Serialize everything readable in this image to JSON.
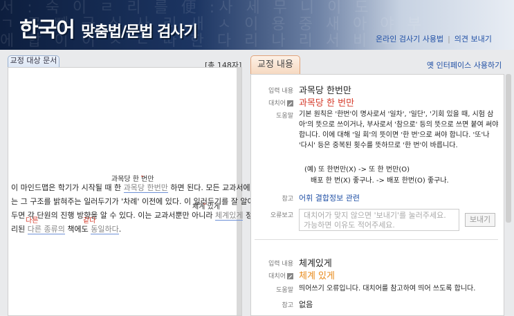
{
  "header": {
    "title_main": "한국어 ",
    "title_rest": "맞춤법/문법 검사기",
    "link_manual": "온라인 검사기 사용법",
    "link_separator": "|",
    "link_feedback": "의견 보내기",
    "bg_glyphs": [
      "서 :  숙 이 ㄹ 리 를    便 :사 세   무 니 이 도",
      "ㄱ 로 빼 금 식 사 리 새 ㅅ  이 용   중 새 아 야 부",
      "에  합 이 이 ㅅ ㄷ 따 한  다 리  나 리   서 비 ㄹ"
    ]
  },
  "left_panel": {
    "tab_label": "교정 대상 문서",
    "char_count": "[총 148자]",
    "lines": [
      {
        "pre": "이 마인드맵은 학기가 시작될 때 한 ",
        "err": "과목당 한번만",
        "post": " 하면 된다. 모든 교과서에",
        "sugg": "과목당 한 번만"
      },
      {
        "pre": "는 그 구조를 밝혀주는 일러두기가 '차례' 이전에 있다. 이 일러두기를 잘 알아",
        "err": "",
        "post": "",
        "sugg": ""
      },
      {
        "pre": "두면 각 단원의 진행 방향을 알 수 있다. 이는 교과서뿐만 아니라 ",
        "err": "체계있게",
        "post": " 정",
        "sugg": "체계 있게"
      },
      {
        "pre": "리된 ",
        "err": "다른 종류의",
        "mid": " 책에도 ",
        "err2": "동일하다",
        "post": ".",
        "sugg": "다른",
        "sugg2": "같다"
      }
    ]
  },
  "right_panel": {
    "tab_label": "교정 내용",
    "old_ui_link": "옛 인터페이스 사용하기",
    "entry1": {
      "input_label": "입력 내용",
      "input_value": "과목당 한번만",
      "replace_label": "대치어",
      "replace_value": "과목당 한 번만",
      "help_label": "도움말",
      "help_text": "기본 원칙은 '한번'이 명사로서 '일차', '일단', '기회 있을 때, 시험 삼아'의 뜻으로 쓰이거나, 부사로서 '참으로' 등의 뜻으로 쓰면 붙여 써야 합니다. 이에 대해 '일 회'의 뜻이면 '한 번'으로 써야 합니다. '또'나 '다시' 등은 중복된 횟수를 뜻하므로 '한 번'이 바릅니다.",
      "example1": "(예) 또 한번만(X) -> 또 한 번만(O)",
      "example2": "배포 한 번(X) 좋구나. -> 배포 한번(O) 좋구나.",
      "ref_label": "참고",
      "ref_value": "어휘 결합정보 관련",
      "report_label": "오류보고",
      "report_placeholder": "대치어가 맞지 않으면 '보내기'를 눌러주세요. 가능하면 이유도 적어주세요.",
      "send_label": "보내기"
    },
    "entry2": {
      "input_label": "입력 내용",
      "input_value": "체계있게",
      "replace_label": "대치어",
      "replace_value": "체계 있게",
      "help_label": "도움말",
      "help_text": "띄어쓰기 오류입니다. 대치어를 참고하여 띄어 쓰도록 합니다.",
      "ref_label": "참고",
      "ref_value": "없음"
    }
  },
  "colors": {
    "accent_red": "#d53a2a",
    "accent_orange": "#e88a1a",
    "link_blue": "#1f4fa5"
  }
}
